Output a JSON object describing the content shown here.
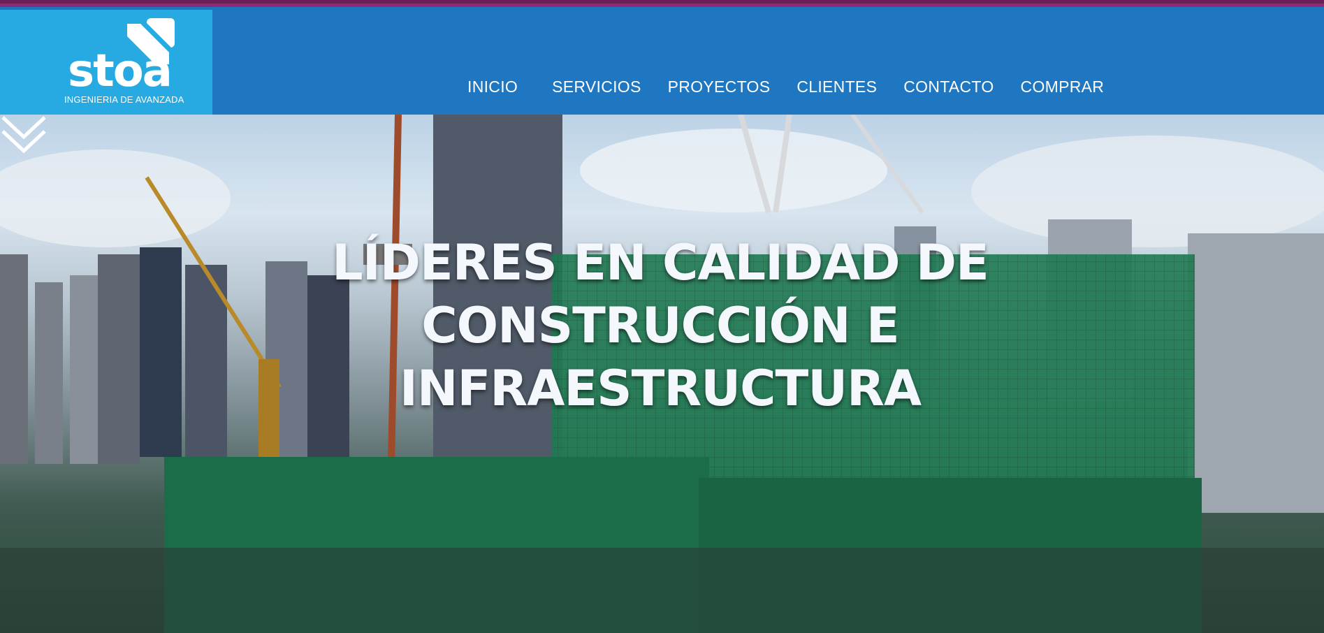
{
  "brand": {
    "name": "stoa",
    "tagline": "INGENIERIA DE AVANZADA",
    "logo_color": "#27aae2",
    "header_color": "#1f76c1"
  },
  "nav": {
    "items": [
      {
        "label": "INICIO"
      },
      {
        "label": "SERVICIOS"
      },
      {
        "label": "PROYECTOS"
      },
      {
        "label": "CLIENTES"
      },
      {
        "label": "CONTACTO"
      },
      {
        "label": "COMPRAR"
      }
    ]
  },
  "hero": {
    "title_line1": "LÍDERES EN CALIDAD DE",
    "title_line2": "CONSTRUCCIÓN E",
    "title_line3": "INFRAESTRUCTURA",
    "scroll_icon": "double-chevron-down-icon",
    "background": "construction-site-photo"
  }
}
